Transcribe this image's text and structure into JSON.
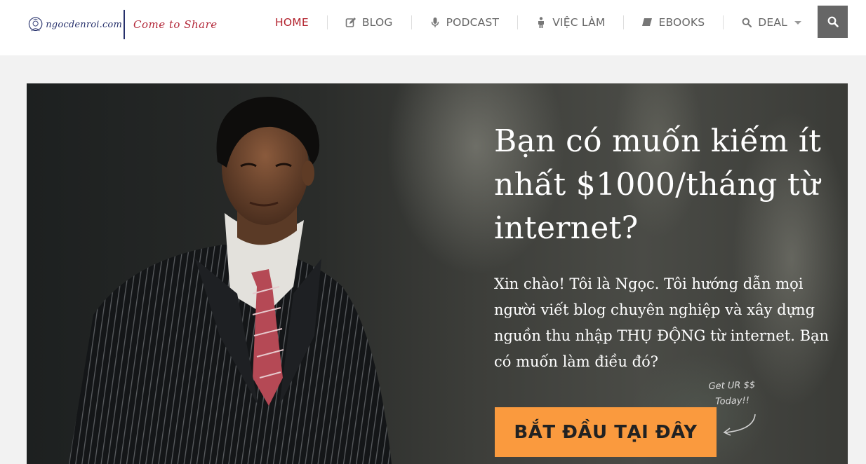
{
  "header": {
    "logo_text": "ngocdenroi.com",
    "tagline": "Come to Share",
    "search_icon": "search-icon"
  },
  "nav": {
    "items": [
      {
        "label": "HOME",
        "icon": "",
        "active": true
      },
      {
        "label": "BLOG",
        "icon": "edit-icon"
      },
      {
        "label": "PODCAST",
        "icon": "microphone-icon"
      },
      {
        "label": "VIỆC LÀM",
        "icon": "person-icon"
      },
      {
        "label": "EBOOKS",
        "icon": "book-icon"
      },
      {
        "label": "DEAL",
        "icon": "search-icon",
        "has_dropdown": true
      }
    ]
  },
  "hero": {
    "title": "Bạn có muốn kiếm ít nhất $1000/tháng từ internet?",
    "subtitle": "Xin chào! Tôi là Ngọc. Tôi hướng dẫn mọi người viết blog chuyên nghiệp và xây dựng nguồn thu nhập THỤ ĐỘNG từ internet. Bạn có muốn làm điều đó?",
    "cta_label": "BẮT ĐẦU TẠI ĐÂY",
    "note_line1": "Get UR $$",
    "note_line2": "Today!!"
  },
  "colors": {
    "accent_red": "#b3242f",
    "cta_orange": "#fa9a3e",
    "search_bg": "#666666"
  }
}
